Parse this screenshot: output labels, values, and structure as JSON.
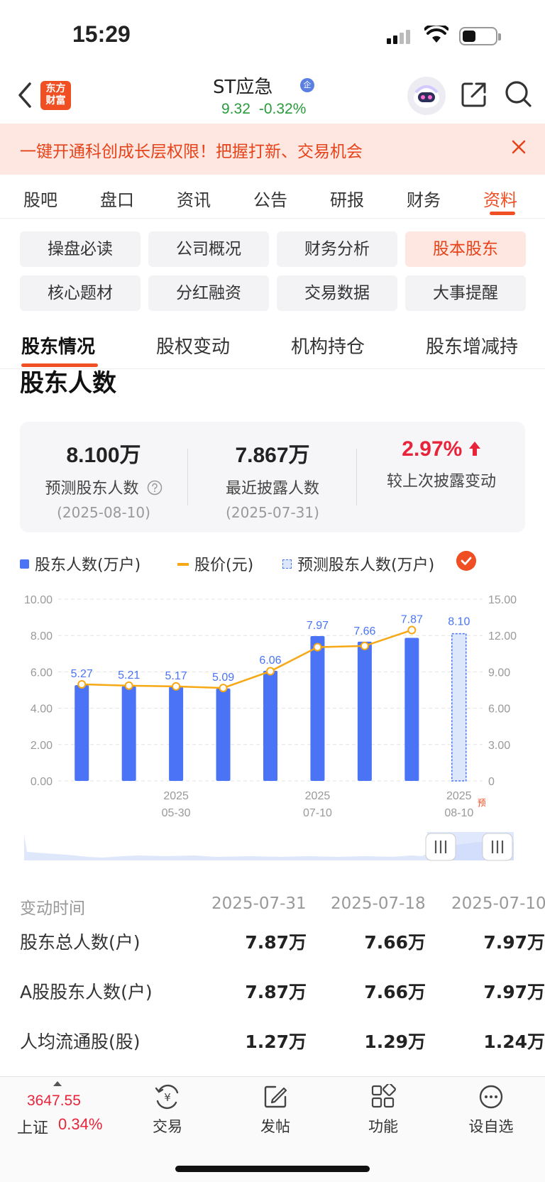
{
  "status_bar": {
    "time": "15:29"
  },
  "header": {
    "logo_text_1": "东方",
    "logo_text_2": "财富",
    "stock_name": "ST应急",
    "badge": "企",
    "price": "9.32",
    "change": "-0.32%"
  },
  "banner": {
    "text": "一键开通科创成长层权限！把握打新、交易机会"
  },
  "main_tabs": [
    "股吧",
    "盘口",
    "资讯",
    "公告",
    "研报",
    "财务",
    "资料"
  ],
  "grid_buttons": [
    "操盘必读",
    "公司概况",
    "财务分析",
    "股本股东",
    "核心题材",
    "分红融资",
    "交易数据",
    "大事提醒"
  ],
  "sub_tabs": [
    "股东情况",
    "股权变动",
    "机构持仓",
    "股东增减持"
  ],
  "section_title": "股东人数",
  "stats": [
    {
      "value": "8.100万",
      "label": "预测股东人数",
      "date": "(2025-08-10)"
    },
    {
      "value": "7.867万",
      "label": "最近披露人数",
      "date": "(2025-07-31)"
    },
    {
      "value": "2.97%",
      "label": "较上次披露变动"
    }
  ],
  "legend": {
    "holders": "股东人数(万户)",
    "price": "股价(元)",
    "forecast": "预测股东人数(万户)"
  },
  "chart_data": {
    "type": "bar",
    "categories": [
      "",
      "",
      "2025-05-30",
      "",
      "",
      "2025-07-10",
      "",
      "",
      "2025-08-10"
    ],
    "x_tick_labels": [
      {
        "year": "2025",
        "date": "05-30"
      },
      {
        "year": "2025",
        "date": "07-10"
      },
      {
        "year": "2025",
        "date": "08-10",
        "suffix": "预"
      }
    ],
    "series": [
      {
        "name": "股东人数(万户)",
        "type": "bar",
        "values": [
          5.27,
          5.21,
          5.17,
          5.09,
          6.06,
          7.97,
          7.66,
          7.87,
          null
        ],
        "labels": [
          "5.27",
          "5.21",
          "5.17",
          "5.09",
          "6.06",
          "7.97",
          "7.66",
          "7.87",
          ""
        ]
      },
      {
        "name": "预测股东人数(万户)",
        "type": "bar-forecast",
        "values": [
          null,
          null,
          null,
          null,
          null,
          null,
          null,
          null,
          8.1
        ],
        "labels": [
          "",
          "",
          "",
          "",
          "",
          "",
          "",
          "",
          "8.10"
        ]
      },
      {
        "name": "股价(元)",
        "type": "line",
        "values": [
          7.97,
          7.86,
          7.8,
          7.67,
          9.05,
          11.04,
          11.14,
          12.45,
          null
        ]
      }
    ],
    "y_left_ticks": [
      "10.00",
      "8.00",
      "6.00",
      "4.00",
      "2.00",
      "0.00"
    ],
    "y_right_ticks": [
      "15.00",
      "12.00",
      "9.00",
      "6.00",
      "3.00",
      "0"
    ],
    "ylim_left": [
      0,
      10
    ],
    "ylim_right": [
      0,
      15
    ],
    "grid": true,
    "colors": {
      "bar": "#4a74f5",
      "line": "#f7a815",
      "forecast_fill": "#dce7fb",
      "label": "#4a74f5"
    }
  },
  "table": {
    "header_label": "变动时间",
    "dates": [
      "2025-07-31",
      "2025-07-18",
      "2025-07-10"
    ],
    "rows": [
      {
        "label": "股东总人数(户)",
        "values": [
          "7.87万",
          "7.66万",
          "7.97万"
        ]
      },
      {
        "label": "A股股东人数(户)",
        "values": [
          "7.87万",
          "7.66万",
          "7.97万"
        ]
      },
      {
        "label": "人均流通股(股)",
        "values": [
          "1.27万",
          "1.29万",
          "1.24万"
        ]
      }
    ]
  },
  "bottom_bar": {
    "index_value": "3647.55",
    "index_name": "上证",
    "index_change": "0.34%",
    "items": [
      "交易",
      "发帖",
      "功能",
      "设自选"
    ]
  },
  "colors": {
    "brand": "#f04e23",
    "up": "#e8243a",
    "down": "#2a9b3c"
  }
}
